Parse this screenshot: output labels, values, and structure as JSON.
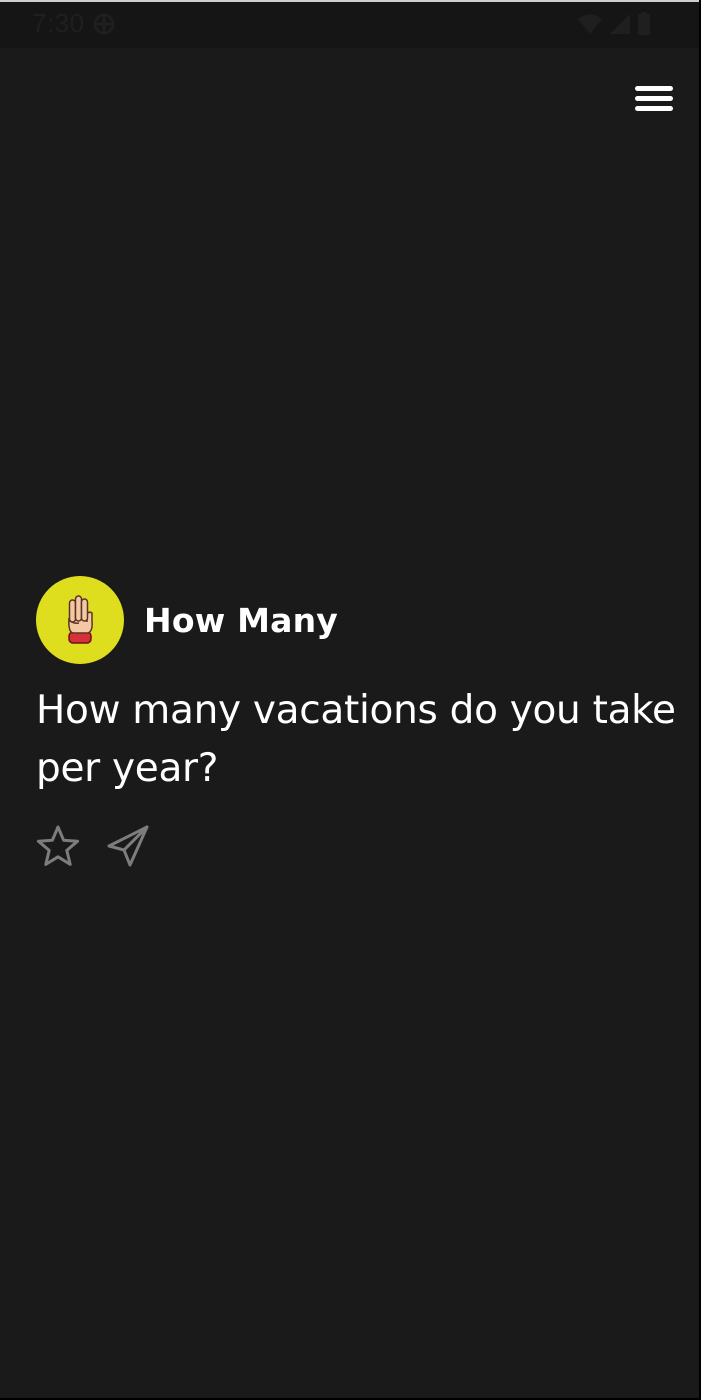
{
  "status_bar": {
    "time": "7:30",
    "icons": [
      "sync-icon",
      "wifi-icon",
      "signal-icon",
      "battery-icon"
    ]
  },
  "header": {
    "menu_icon": "hamburger-menu-icon"
  },
  "card": {
    "category": "How Many",
    "avatar_icon": "three-fingers-hand-icon",
    "avatar_color": "#dede1e",
    "question": "How many vacations do you take per year?",
    "actions": [
      "star-icon",
      "send-icon"
    ]
  },
  "colors": {
    "background": "#1a1a1b",
    "text": "#ffffff",
    "icon_muted": "#7d7d7d"
  }
}
